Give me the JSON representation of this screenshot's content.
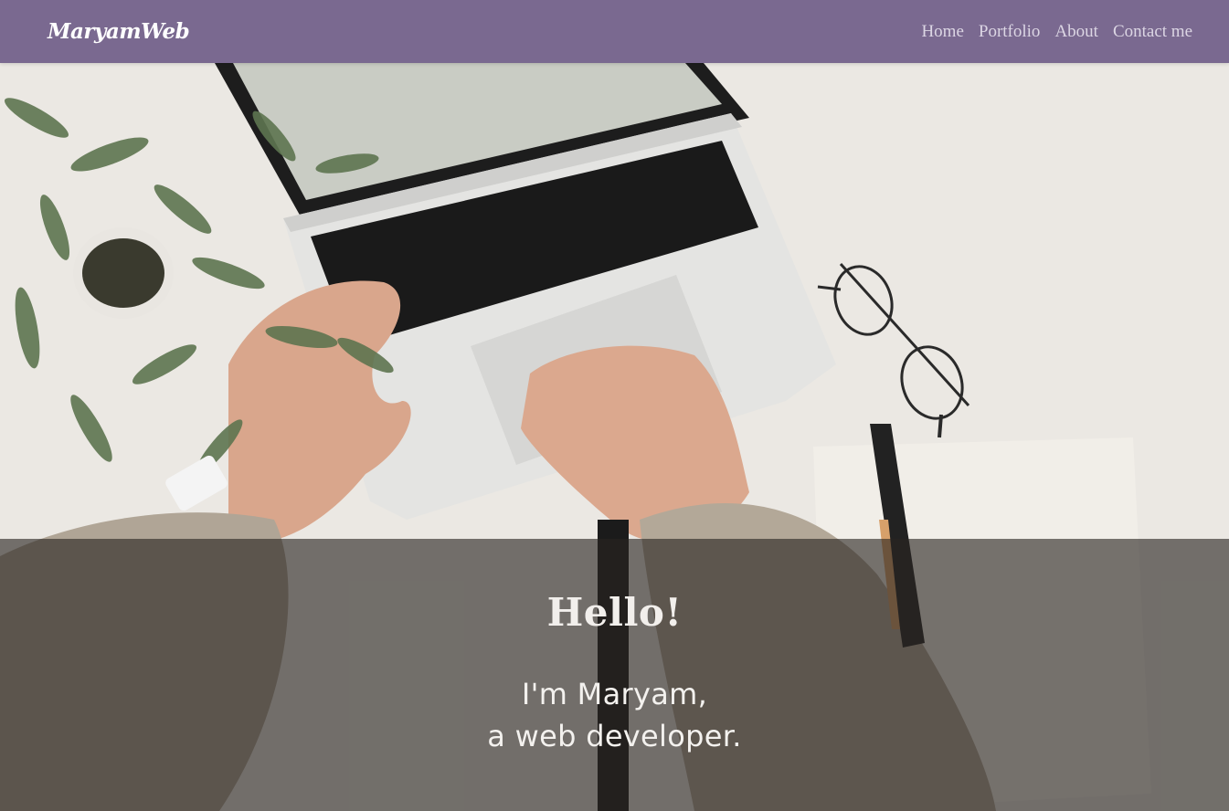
{
  "brand": "MaryamWeb",
  "nav": {
    "items": [
      {
        "label": "Home"
      },
      {
        "label": "Portfolio"
      },
      {
        "label": "About"
      },
      {
        "label": "Contact me"
      }
    ]
  },
  "hero": {
    "heading": "Hello!",
    "line1": "I'm Maryam,",
    "line2": "a web developer."
  },
  "colors": {
    "navbar_bg": "#7a6990",
    "nav_link": "#dcd6e4",
    "overlay": "rgba(40,36,32,0.62)"
  }
}
